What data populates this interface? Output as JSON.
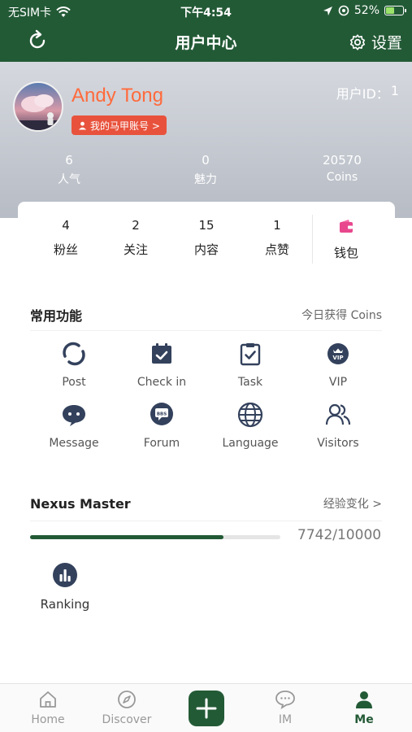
{
  "status_bar": {
    "carrier": "无SIM卡",
    "time": "下午4:54",
    "battery": "52%",
    "battery_level": 0.52
  },
  "nav": {
    "title": "用户中心",
    "settings_label": "设置"
  },
  "profile": {
    "name": "Andy Tong",
    "account_badge": "我的马甲账号 >",
    "user_id_label": "用户ID：",
    "user_id": "1",
    "stats": [
      {
        "value": "6",
        "label": "人气"
      },
      {
        "value": "0",
        "label": "魅力"
      },
      {
        "value": "20570",
        "label": "Coins"
      }
    ]
  },
  "card": {
    "stats": [
      {
        "value": "4",
        "label": "粉丝"
      },
      {
        "value": "2",
        "label": "关注"
      },
      {
        "value": "15",
        "label": "内容"
      },
      {
        "value": "1",
        "label": "点赞"
      }
    ],
    "wallet_label": "钱包"
  },
  "functions": {
    "title": "常用功能",
    "right": "今日获得 Coins",
    "items": [
      {
        "label": "Post",
        "icon": "post-icon"
      },
      {
        "label": "Check in",
        "icon": "calendar-check-icon"
      },
      {
        "label": "Task",
        "icon": "clipboard-check-icon"
      },
      {
        "label": "VIP",
        "icon": "vip-icon"
      },
      {
        "label": "Message",
        "icon": "message-icon"
      },
      {
        "label": "Forum",
        "icon": "forum-icon"
      },
      {
        "label": "Language",
        "icon": "globe-icon"
      },
      {
        "label": "Visitors",
        "icon": "visitors-icon"
      }
    ]
  },
  "level": {
    "title": "Nexus Master",
    "right": "经验变化 >",
    "progress_text": "7742/10000",
    "progress_fraction": 0.7742
  },
  "ranking": {
    "label": "Ranking"
  },
  "tabs": [
    {
      "label": "Home"
    },
    {
      "label": "Discover"
    },
    {
      "label": "IM"
    },
    {
      "label": "Me"
    }
  ],
  "colors": {
    "brand": "#235a36",
    "name": "#ff6a3c",
    "badge": "#e8523c"
  }
}
